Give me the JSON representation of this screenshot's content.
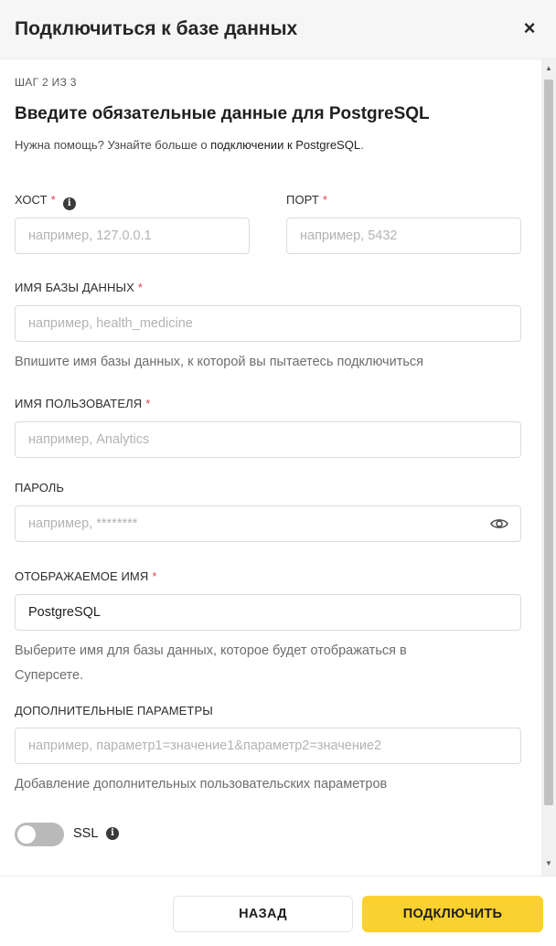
{
  "modal": {
    "title": "Подключиться к базе данных",
    "close_icon": "×"
  },
  "step": {
    "label": "ШАГ 2 ИЗ 3",
    "heading": "Введите обязательные данные для PostgreSQL",
    "help_prefix": "Нужна помощь? Узнайте больше о ",
    "help_link": "подключении к PostgreSQL",
    "help_suffix": "."
  },
  "fields": {
    "host": {
      "label": "ХОСТ",
      "required": "*",
      "placeholder": "например, 127.0.0.1",
      "value": ""
    },
    "port": {
      "label": "ПОРТ",
      "required": "*",
      "placeholder": "например, 5432",
      "value": ""
    },
    "database": {
      "label": "ИМЯ БАЗЫ ДАННЫХ",
      "required": "*",
      "placeholder": "например, health_medicine",
      "value": "",
      "hint": "Впишите имя базы данных, к которой вы пытаетесь подключиться"
    },
    "username": {
      "label": "ИМЯ ПОЛЬЗОВАТЕЛЯ",
      "required": "*",
      "placeholder": "например, Analytics",
      "value": ""
    },
    "password": {
      "label": "ПАРОЛЬ",
      "placeholder": "например, ********",
      "value": ""
    },
    "display_name": {
      "label": "ОТОБРАЖАЕМОЕ ИМЯ",
      "required": "*",
      "placeholder": "",
      "value": "PostgreSQL",
      "hint_line1": "Выберите имя для базы данных, которое будет отображаться в",
      "hint_line2": "Суперсете."
    },
    "extra_params": {
      "label": "ДОПОЛНИТЕЛЬНЫЕ ПАРАМЕТРЫ",
      "placeholder": "например, параметр1=значение1&параметр2=значение2",
      "value": "",
      "hint": "Добавление дополнительных пользовательских параметров"
    }
  },
  "ssl": {
    "label": "SSL",
    "enabled": false
  },
  "icons": {
    "info": "i",
    "password_visibility": "eye-icon",
    "scroll_up": "▲",
    "scroll_down": "▼"
  },
  "footer": {
    "back_label": "НАЗАД",
    "connect_label": "ПОДКЛЮЧИТЬ"
  },
  "colors": {
    "accent": "#fad12f",
    "required": "#e04355",
    "header_bg": "#f6f6f6"
  }
}
